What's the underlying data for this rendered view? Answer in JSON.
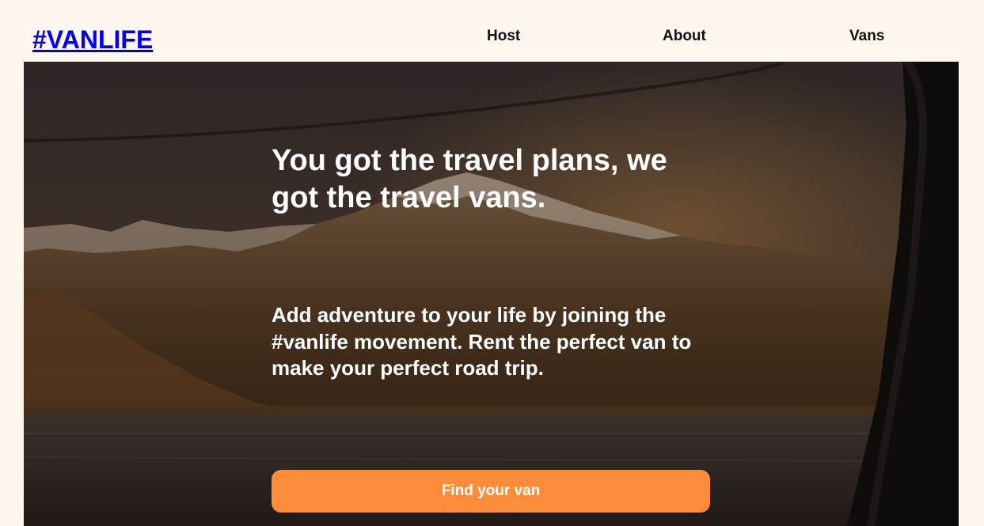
{
  "header": {
    "logo": "#VANLIFE",
    "nav": [
      {
        "label": "Host"
      },
      {
        "label": "About"
      },
      {
        "label": "Vans"
      }
    ]
  },
  "hero": {
    "title": "You got the travel plans, we got the travel vans.",
    "subtitle": "Add adventure to your life by joining the #vanlife movement. Rent the perfect van to make your perfect road trip.",
    "cta_label": "Find your van"
  },
  "colors": {
    "page_background": "#FFF7ED",
    "logo_link": "#0000EE",
    "nav_text": "#111111",
    "cta_background": "#FF8C38",
    "hero_text": "#FFFFFF"
  }
}
